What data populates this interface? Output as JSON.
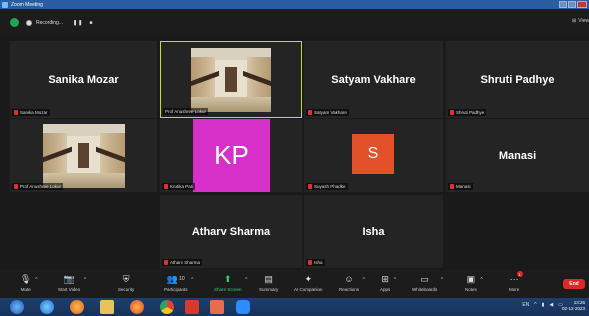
{
  "window": {
    "title": "Zoom Meeting"
  },
  "topbar": {
    "recording_label": "Recording...",
    "pause_label": "❚❚",
    "stop_label": "■",
    "view_label": "View"
  },
  "tiles": [
    {
      "name": "Sanika Mozar",
      "tag": "Sanika Mozar",
      "kind": "name"
    },
    {
      "name": "",
      "tag": "Prof Anushree Lokur",
      "kind": "video"
    },
    {
      "name": "Satyam Vakhare",
      "tag": "Satyam Vakhare",
      "kind": "name"
    },
    {
      "name": "Shruti Padhye",
      "tag": "Shruti Padhye",
      "kind": "name"
    },
    {
      "name": "",
      "tag": "Prof Anushree Lokur",
      "kind": "video"
    },
    {
      "name": "KP",
      "tag": "Krutika Pati",
      "kind": "avatar",
      "color": "#d630c9"
    },
    {
      "name": "S",
      "tag": "Suyash Phadke",
      "kind": "avatar",
      "color": "#e2512a"
    },
    {
      "name": "Manasi",
      "tag": "Manasi",
      "kind": "name"
    },
    {
      "name": "Atharv Sharma",
      "tag": "Atharv Sharma",
      "kind": "name"
    },
    {
      "name": "Isha",
      "tag": "Isha",
      "kind": "name"
    }
  ],
  "toolbar": {
    "mute": "Mute",
    "start_video": "Start Video",
    "security": "Security",
    "participants": "Participants",
    "participants_count": "10",
    "share_screen": "Share Screen",
    "summary": "Summary",
    "ai_companion": "AI Companion",
    "reactions": "Reactions",
    "apps": "Apps",
    "whiteboards": "Whiteboards",
    "notes": "Notes",
    "more": "More",
    "more_badge": "1",
    "end": "End"
  },
  "taskbar": {
    "lang": "EN",
    "time": "13:26",
    "date": "02-12-2023"
  },
  "colors": {
    "active_border": "#c5d93a",
    "end_red": "#e02828",
    "share_green": "#2fd27a"
  }
}
